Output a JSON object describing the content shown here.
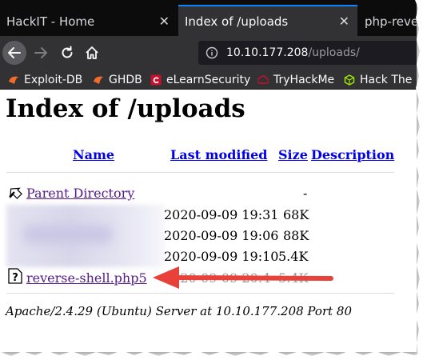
{
  "browser": {
    "tabs": [
      {
        "title": "HackIT - Home",
        "close": "✕"
      },
      {
        "title": "Index of /uploads",
        "close": "✕"
      },
      {
        "title": "php-reve"
      }
    ],
    "url": {
      "host": "10.10.177.208",
      "path": "/uploads/"
    },
    "bookmarks": [
      {
        "label": "Exploit-DB",
        "icon": "exploit-db-icon"
      },
      {
        "label": "GHDB",
        "icon": "ghdb-icon"
      },
      {
        "label": "eLearnSecurity",
        "icon": "elearnsecurity-icon"
      },
      {
        "label": "TryHackMe",
        "icon": "tryhackme-icon"
      },
      {
        "label": "Hack The",
        "icon": "hackthebox-icon"
      }
    ]
  },
  "page": {
    "title": "Index of /uploads",
    "columns": {
      "name": "Name",
      "modified": "Last modified",
      "size": "Size",
      "description": "Description"
    },
    "parent": {
      "name": "Parent Directory",
      "size": "-"
    },
    "rows": [
      {
        "modified": "2020-09-09 19:31",
        "size": "68K"
      },
      {
        "modified": "2020-09-09 19:06",
        "size": "88K"
      },
      {
        "modified": "2020-09-09 19:10",
        "size": "5.4K"
      }
    ],
    "file": {
      "name": "reverse-shell.php5",
      "modified_partial": "2020-09-09 20:4",
      "size": "5.4K"
    },
    "address": "Apache/2.4.29 (Ubuntu) Server at 10.10.177.208 Port 80"
  },
  "colors": {
    "annotation_arrow": "#e8413a",
    "link": "#551a8b",
    "header_link": "#0000ee"
  }
}
